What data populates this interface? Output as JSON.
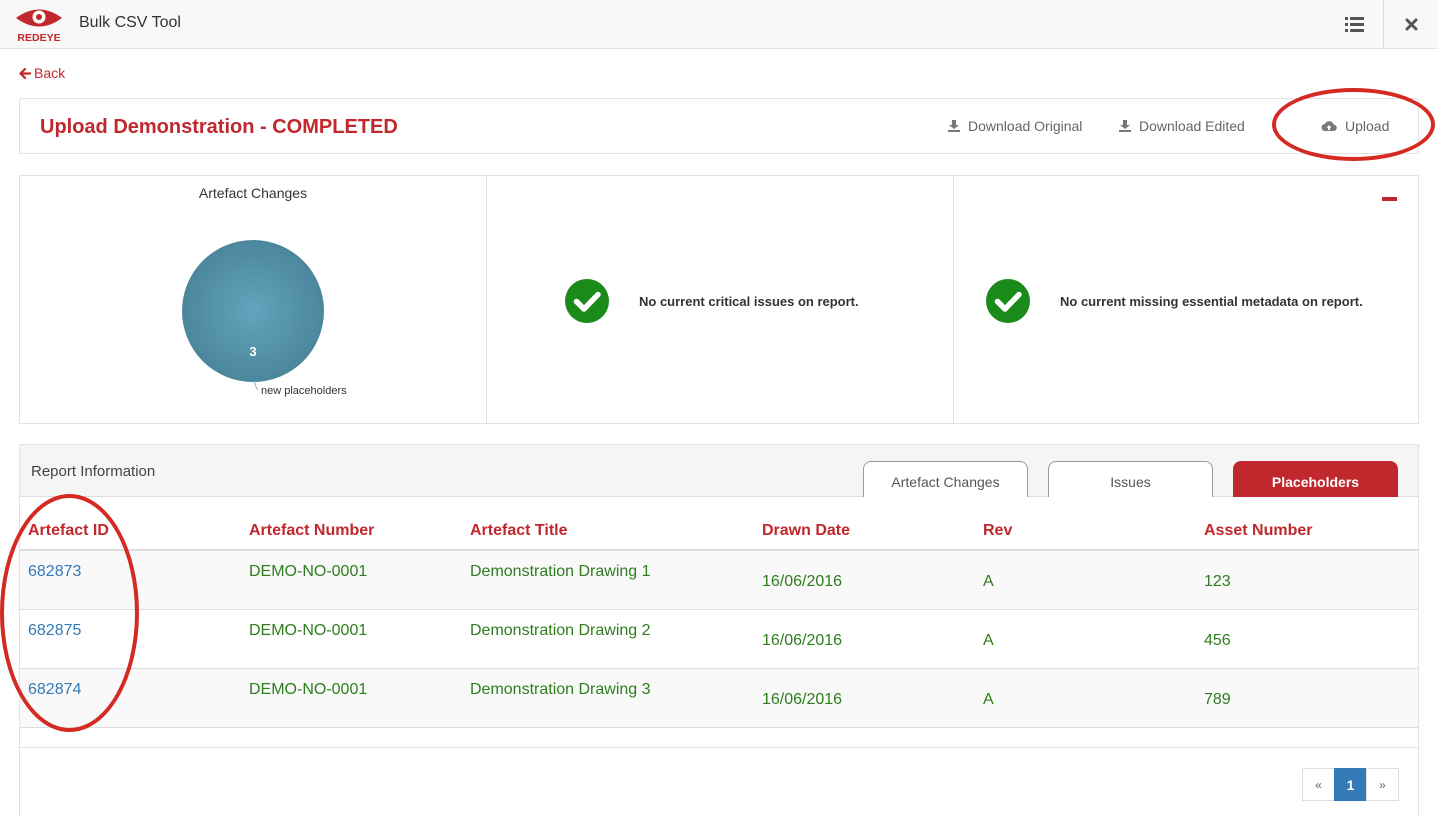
{
  "app": {
    "title": "Bulk CSV Tool",
    "logo_text": "REDEYE"
  },
  "nav": {
    "back_label": "Back"
  },
  "header": {
    "title": "Upload Demonstration - COMPLETED",
    "download_original": "Download Original",
    "download_edited": "Download Edited",
    "upload": "Upload"
  },
  "summary": {
    "chart_title": "Artefact Changes",
    "critical_status": "No current critical issues on report.",
    "metadata_status": "No current missing essential metadata on report."
  },
  "chart_data": {
    "type": "pie",
    "title": "Artefact Changes",
    "categories": [
      "new placeholders"
    ],
    "values": [
      3
    ],
    "colors": [
      "#5597ad"
    ]
  },
  "report": {
    "title": "Report Information",
    "tabs": [
      {
        "label": "Artefact Changes",
        "active": false
      },
      {
        "label": "Issues",
        "active": false
      },
      {
        "label": "Placeholders",
        "active": true
      }
    ],
    "columns": [
      "Artefact ID",
      "Artefact Number",
      "Artefact Title",
      "Drawn Date",
      "Rev",
      "Asset Number"
    ],
    "rows": [
      [
        "682873",
        "DEMO-NO-0001",
        "Demonstration Drawing 1",
        "16/06/2016",
        "A",
        "123"
      ],
      [
        "682875",
        "DEMO-NO-0001",
        "Demonstration Drawing 2",
        "16/06/2016",
        "A",
        "456"
      ],
      [
        "682874",
        "DEMO-NO-0001",
        "Demonstration Drawing 3",
        "16/06/2016",
        "A",
        "789"
      ]
    ]
  },
  "pagination": {
    "prev": "«",
    "current": "1",
    "next": "»"
  },
  "colors": {
    "brand_red": "#c0282d",
    "link_blue": "#337ab7",
    "value_green": "#2e7d1e",
    "success_green": "#1a8a1a",
    "annotation_red": "#d42a22"
  }
}
